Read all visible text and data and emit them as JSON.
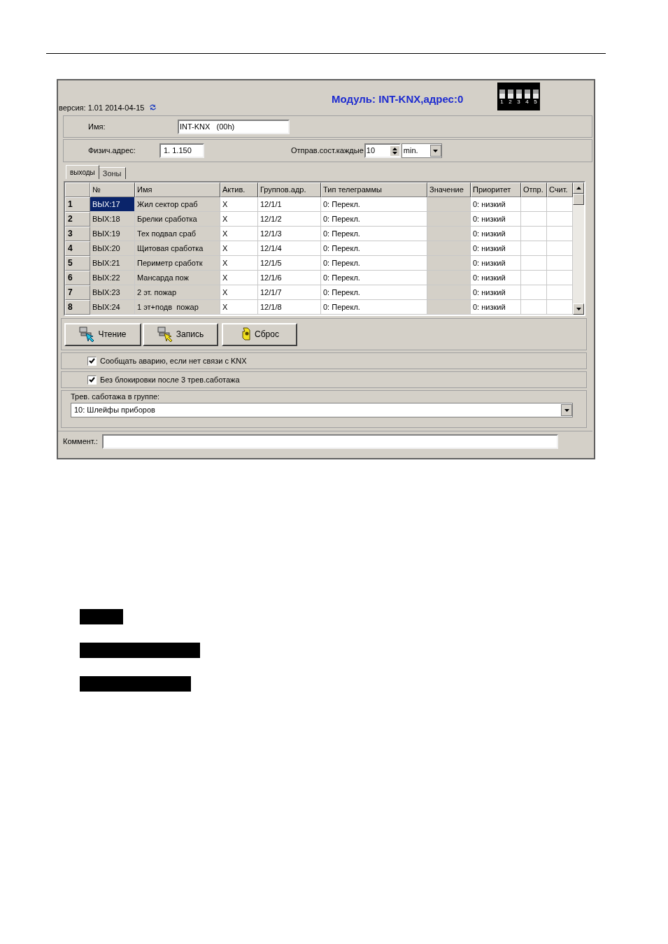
{
  "window": {
    "version": "версия: 1.01 2014-04-15",
    "title": "Модуль: INT-KNX,адрес:0",
    "dip_switch": [
      {
        "label": "1",
        "on": false
      },
      {
        "label": "2",
        "on": false
      },
      {
        "label": "3",
        "on": false
      },
      {
        "label": "4",
        "on": false
      },
      {
        "label": "5",
        "on": false
      }
    ]
  },
  "name_field": {
    "label": "Имя:",
    "value": "INT-KNX   (00h)"
  },
  "address_field": {
    "label": "Физич.адрес:",
    "value": "1. 1.150"
  },
  "send_interval": {
    "label": "Отправ.сост.каждые",
    "value": "10",
    "unit": "min."
  },
  "tabs": [
    {
      "label": "выходы",
      "selected": true
    },
    {
      "label": "Зоны",
      "selected": false
    }
  ],
  "table": {
    "columns": [
      "№",
      "Имя",
      "Актив.",
      "Группов.адр.",
      "Тип телеграммы",
      "Значение",
      "Приоритет",
      "Отпр.",
      "Счит."
    ],
    "rows": [
      {
        "index": "1",
        "cells": [
          "ВЫХ:17",
          "Жил сектор сраб",
          "X",
          "12/1/1",
          "0: Перекл.",
          "",
          "0: низкий",
          "",
          ""
        ],
        "selected": true
      },
      {
        "index": "2",
        "cells": [
          "ВЫХ:18",
          "Брелки сработка",
          "X",
          "12/1/2",
          "0: Перекл.",
          "",
          "0: низкий",
          "",
          ""
        ],
        "selected": false
      },
      {
        "index": "3",
        "cells": [
          "ВЫХ:19",
          "Тех подвал сраб",
          "X",
          "12/1/3",
          "0: Перекл.",
          "",
          "0: низкий",
          "",
          ""
        ],
        "selected": false
      },
      {
        "index": "4",
        "cells": [
          "ВЫХ:20",
          "Щитовая сработка",
          "X",
          "12/1/4",
          "0: Перекл.",
          "",
          "0: низкий",
          "",
          ""
        ],
        "selected": false
      },
      {
        "index": "5",
        "cells": [
          "ВЫХ:21",
          "Периметр сработк",
          "X",
          "12/1/5",
          "0: Перекл.",
          "",
          "0: низкий",
          "",
          ""
        ],
        "selected": false
      },
      {
        "index": "6",
        "cells": [
          "ВЫХ:22",
          "Мансарда пож",
          "X",
          "12/1/6",
          "0: Перекл.",
          "",
          "0: низкий",
          "",
          ""
        ],
        "selected": false
      },
      {
        "index": "7",
        "cells": [
          "ВЫХ:23",
          "2 эт. пожар",
          "X",
          "12/1/7",
          "0: Перекл.",
          "",
          "0: низкий",
          "",
          ""
        ],
        "selected": false
      },
      {
        "index": "8",
        "cells": [
          "ВЫХ:24",
          "1 эт+подв  пожар",
          "X",
          "12/1/8",
          "0: Перекл.",
          "",
          "0: низкий",
          "",
          ""
        ],
        "selected": false
      }
    ]
  },
  "buttons": [
    {
      "label": "Чтение",
      "kind": "read"
    },
    {
      "label": "Запись",
      "kind": "write"
    },
    {
      "label": "Сброс",
      "kind": "reset"
    }
  ],
  "options": [
    {
      "label": "Сообщать аварию, если нет связи с KNX",
      "checked": true
    },
    {
      "label": "Без блокировки после 3 трев.саботажа",
      "checked": true
    }
  ],
  "tamper_group": {
    "label": "Трев. саботажа в группе:",
    "value": "10: Шлейфы приборов"
  },
  "comment": {
    "label": "Коммент.:"
  }
}
